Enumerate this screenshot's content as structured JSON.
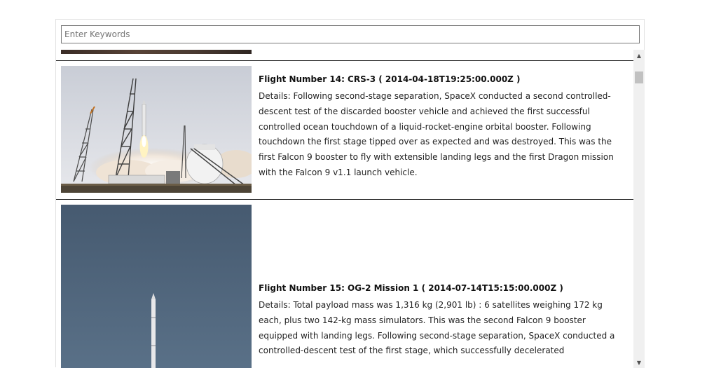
{
  "search": {
    "placeholder": "Enter Keywords",
    "value": ""
  },
  "launches": [
    {
      "title": "Flight Number 14: CRS-3 ( 2014-04-18T19:25:00.000Z )",
      "details": "Details: Following second-stage separation, SpaceX conducted a second controlled-descent test of the discarded booster vehicle and achieved the first successful controlled ocean touchdown of a liquid-rocket-engine orbital booster. Following touchdown the first stage tipped over as expected and was destroyed. This was the first Falcon 9 booster to fly with extensible landing legs and the first Dragon mission with the Falcon 9 v1.1 launch vehicle."
    },
    {
      "title": "Flight Number 15: OG-2 Mission 1 ( 2014-07-14T15:15:00.000Z )",
      "details": "Details: Total payload mass was 1,316 kg (2,901 lb) : 6 satellites weighing 172 kg each, plus two 142-kg mass simulators. This was the second Falcon 9 booster equipped with landing legs. Following second-stage separation, SpaceX conducted a controlled-descent test of the first stage, which successfully decelerated"
    }
  ],
  "scrollbar": {
    "up_arrow": "▲",
    "down_arrow": "▼"
  }
}
